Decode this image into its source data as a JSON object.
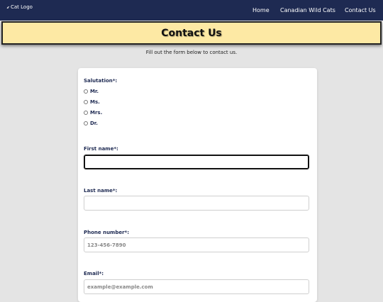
{
  "nav": {
    "logo_text": "Cat Logo",
    "logo_icon": "image-icon",
    "links": [
      "Home",
      "Canadian Wild Cats",
      "Contact Us"
    ]
  },
  "banner": {
    "title": "Contact Us"
  },
  "intro": "Fill out the form below to contact us.",
  "form": {
    "salutation": {
      "label": "Salutation*:",
      "options": [
        "Mr.",
        "Ms.",
        "Mrs.",
        "Dr."
      ]
    },
    "first_name": {
      "label": "First name*:",
      "value": "",
      "placeholder": ""
    },
    "last_name": {
      "label": "Last name*:",
      "value": "",
      "placeholder": ""
    },
    "phone": {
      "label": "Phone number*:",
      "placeholder": "123-456-7890"
    },
    "email": {
      "label": "Email*:",
      "placeholder": "example@example.com"
    }
  },
  "colors": {
    "navbar": "#1e2a52",
    "banner": "#fde9a4",
    "label": "#1e2a52",
    "page_bg": "#e4e4e4"
  }
}
